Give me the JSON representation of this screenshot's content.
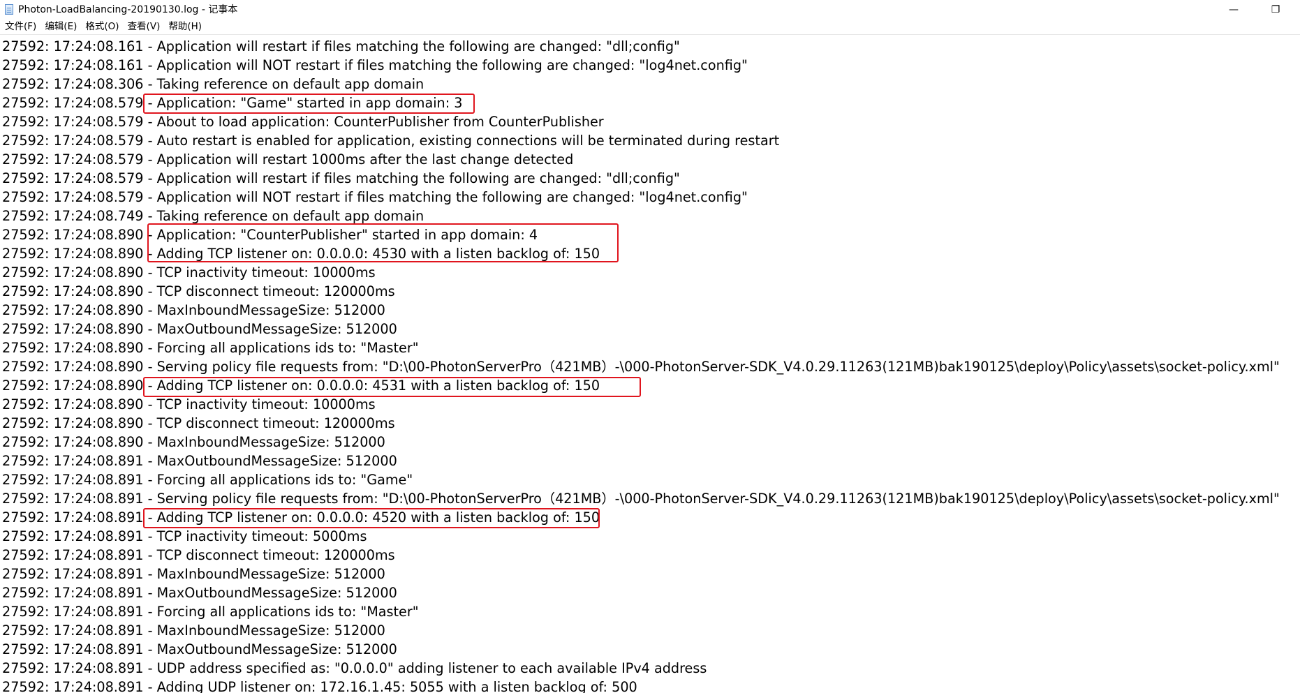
{
  "window": {
    "title": "Photon-LoadBalancing-20190130.log - 记事本",
    "minimize_glyph": "—",
    "restore_glyph": "❐"
  },
  "menu": [
    {
      "label": "文件(F)"
    },
    {
      "label": "编辑(E)"
    },
    {
      "label": "格式(O)"
    },
    {
      "label": "查看(V)"
    },
    {
      "label": "帮助(H)"
    }
  ],
  "log_lines": [
    "27592: 17:24:08.161 - Application will restart if files matching the following are changed: \"dll;config\"",
    "27592: 17:24:08.161 - Application will NOT restart if files matching the following are changed: \"log4net.config\"",
    "27592: 17:24:08.306 - Taking reference on default app domain",
    "27592: 17:24:08.579 - Application: \"Game\" started in app domain: 3",
    "27592: 17:24:08.579 - About to load application: CounterPublisher from CounterPublisher",
    "27592: 17:24:08.579 - Auto restart is enabled for application, existing connections will be terminated during restart",
    "27592: 17:24:08.579 - Application will restart 1000ms after the last change detected",
    "27592: 17:24:08.579 - Application will restart if files matching the following are changed: \"dll;config\"",
    "27592: 17:24:08.579 - Application will NOT restart if files matching the following are changed: \"log4net.config\"",
    "27592: 17:24:08.749 - Taking reference on default app domain",
    "27592: 17:24:08.890 - Application: \"CounterPublisher\" started in app domain: 4",
    "27592: 17:24:08.890 - Adding TCP listener on: 0.0.0.0: 4530 with a listen backlog of: 150",
    "27592: 17:24:08.890 - TCP inactivity timeout: 10000ms",
    "27592: 17:24:08.890 - TCP disconnect timeout: 120000ms",
    "27592: 17:24:08.890 - MaxInboundMessageSize: 512000",
    "27592: 17:24:08.890 - MaxOutboundMessageSize: 512000",
    "27592: 17:24:08.890 - Forcing all applications ids to: \"Master\"",
    "27592: 17:24:08.890 - Serving policy file requests from: \"D:\\00-PhotonServerPro（421MB）-\\000-PhotonServer-SDK_V4.0.29.11263(121MB)bak190125\\deploy\\Policy\\assets\\socket-policy.xml\"",
    "27592: 17:24:08.890 - Adding TCP listener on: 0.0.0.0: 4531 with a listen backlog of: 150",
    "27592: 17:24:08.890 - TCP inactivity timeout: 10000ms",
    "27592: 17:24:08.890 - TCP disconnect timeout: 120000ms",
    "27592: 17:24:08.890 - MaxInboundMessageSize: 512000",
    "27592: 17:24:08.891 - MaxOutboundMessageSize: 512000",
    "27592: 17:24:08.891 - Forcing all applications ids to: \"Game\"",
    "27592: 17:24:08.891 - Serving policy file requests from: \"D:\\00-PhotonServerPro（421MB）-\\000-PhotonServer-SDK_V4.0.29.11263(121MB)bak190125\\deploy\\Policy\\assets\\socket-policy.xml\"",
    "27592: 17:24:08.891 - Adding TCP listener on: 0.0.0.0: 4520 with a listen backlog of: 150",
    "27592: 17:24:08.891 - TCP inactivity timeout: 5000ms",
    "27592: 17:24:08.891 - TCP disconnect timeout: 120000ms",
    "27592: 17:24:08.891 - MaxInboundMessageSize: 512000",
    "27592: 17:24:08.891 - MaxOutboundMessageSize: 512000",
    "27592: 17:24:08.891 - Forcing all applications ids to: \"Master\"",
    "27592: 17:24:08.891 - MaxInboundMessageSize: 512000",
    "27592: 17:24:08.891 - MaxOutboundMessageSize: 512000",
    "27592: 17:24:08.891 - UDP address specified as: \"0.0.0.0\" adding listener to each available IPv4 address",
    "27592: 17:24:08.891 - Adding UDP listener on: 172.16.1.45: 5055 with a listen backlog of: 500"
  ],
  "annotation_color": "#e0151e"
}
